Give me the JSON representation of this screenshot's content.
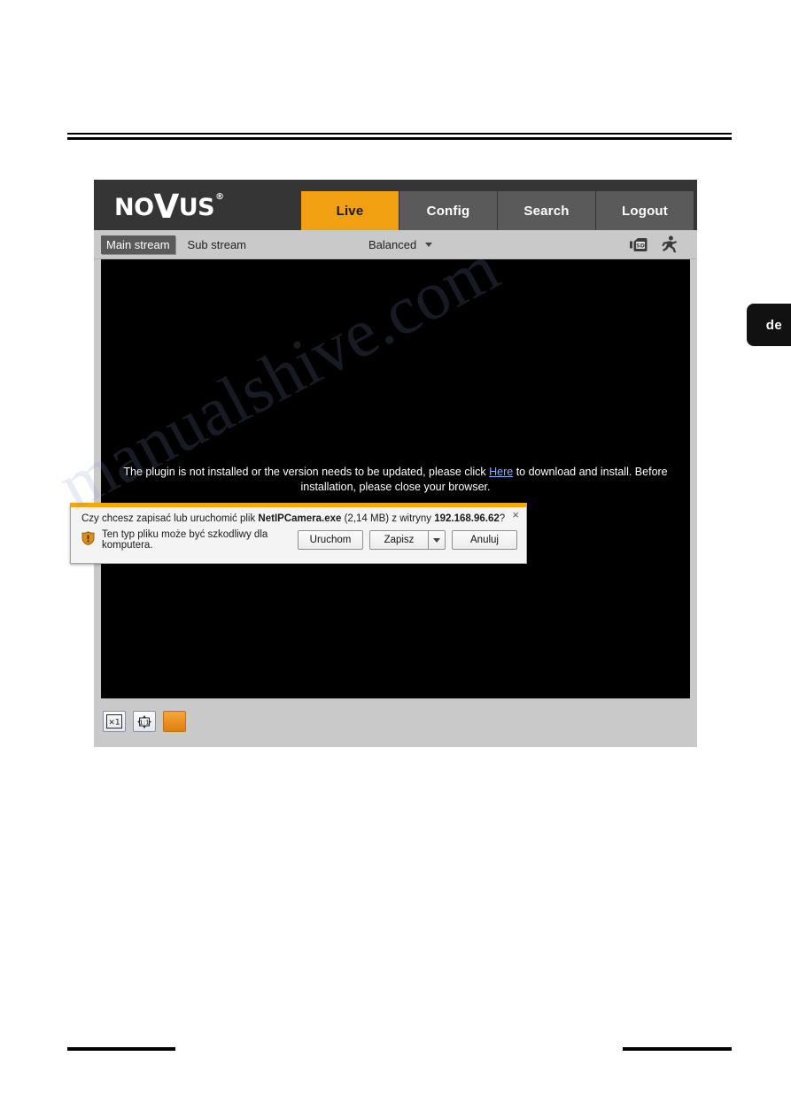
{
  "page": {
    "side_tab_label": "de",
    "watermark_text": "manualshive.com"
  },
  "app": {
    "logo": {
      "prefix": "NO",
      "v": "V",
      "suffix": "US",
      "registered": "®"
    },
    "nav": [
      {
        "label": "Live",
        "active": true
      },
      {
        "label": "Config",
        "active": false
      },
      {
        "label": "Search",
        "active": false
      },
      {
        "label": "Logout",
        "active": false
      }
    ],
    "accent_color": "#f0a011",
    "header_bg": "#353535",
    "toolbar": {
      "streams": [
        {
          "label": "Main stream",
          "active": true
        },
        {
          "label": "Sub stream",
          "active": false
        }
      ],
      "quality_label": "Balanced",
      "icons": [
        {
          "name": "sd-card-icon"
        },
        {
          "name": "motion-detection-icon"
        }
      ]
    },
    "video": {
      "message_part1": "The plugin is not installed or the version needs to be updated, please click ",
      "message_link": "Here",
      "message_part2": " to download and install. Before installation, please close your browser."
    },
    "player_controls": [
      {
        "label": "×1",
        "name": "original-size-button"
      },
      {
        "label": "1:1",
        "name": "fit-window-button"
      },
      {
        "label": "",
        "name": "capture-button"
      }
    ]
  },
  "download_bar": {
    "question_prefix": "Czy chcesz zapisać lub uruchomić plik ",
    "file_name": "NetIPCamera.exe",
    "file_size": " (2,14 MB) ",
    "from_label": "z witryny ",
    "host": "192.168.96.62",
    "question_suffix": "?",
    "warning_text": "Ten typ pliku może być szkodliwy dla komputera.",
    "buttons": {
      "run": "Uruchom",
      "save": "Zapisz",
      "cancel": "Anuluj"
    },
    "close_label": "×",
    "accent_color": "#f2a900"
  }
}
